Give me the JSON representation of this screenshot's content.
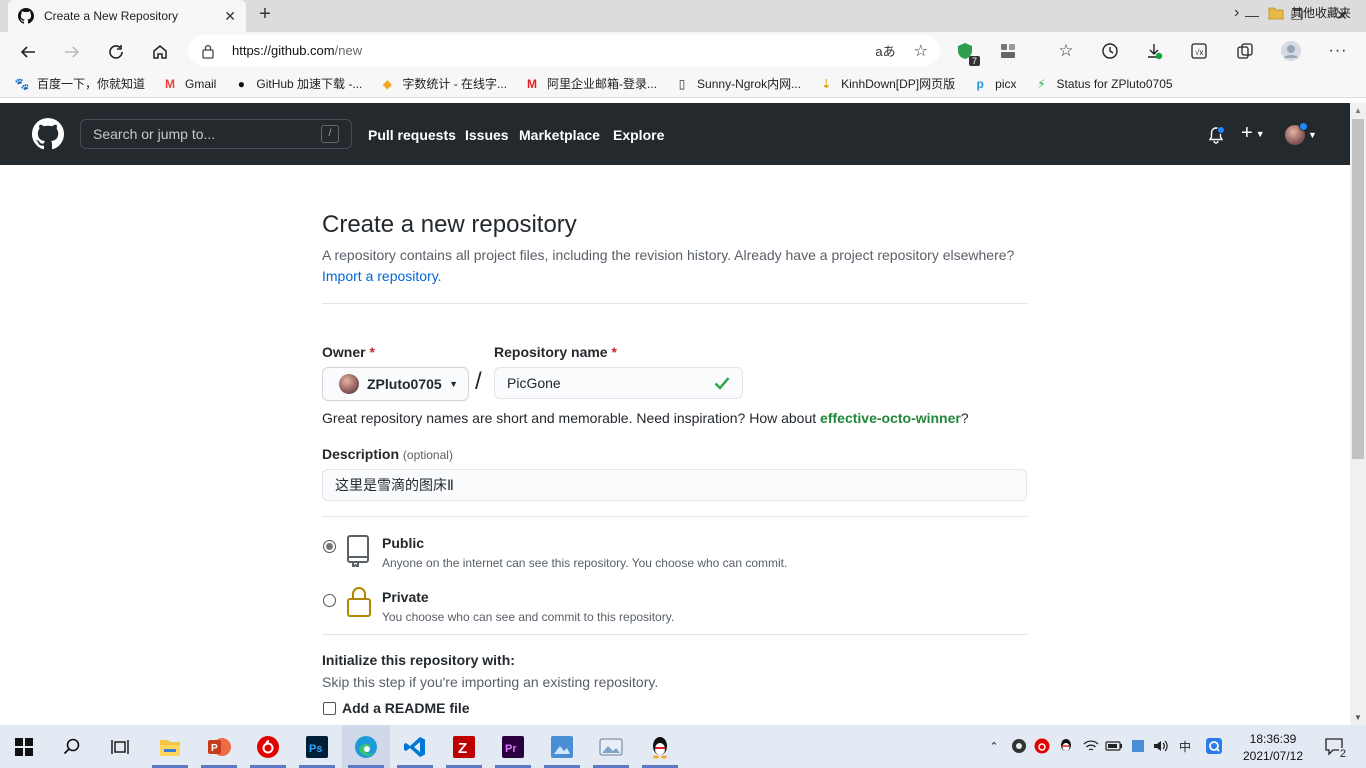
{
  "browser": {
    "tab_title": "Create a New Repository",
    "url_host": "https://github.com",
    "url_path": "/new",
    "extension_badge": "7",
    "bookmarks": [
      {
        "label": "百度一下，你就知道",
        "icon": "baidu-icon",
        "color": "#2932e1",
        "glyph": "🐾"
      },
      {
        "label": "Gmail",
        "icon": "gmail-icon",
        "color": "#ea4335",
        "glyph": "M"
      },
      {
        "label": "GitHub 加速下载 -...",
        "icon": "github-icon",
        "color": "#111111",
        "glyph": "●"
      },
      {
        "label": "字数统计 - 在线字...",
        "icon": "count-icon",
        "color": "#f5a623",
        "glyph": "◆"
      },
      {
        "label": "阿里企业邮箱-登录...",
        "icon": "aliyun-mail-icon",
        "color": "#e02020",
        "glyph": "M"
      },
      {
        "label": "Sunny-Ngrok内网...",
        "icon": "page-icon",
        "color": "#333333",
        "glyph": "▯"
      },
      {
        "label": "KinhDown[DP]网页版",
        "icon": "download-icon",
        "color": "#d9a400",
        "glyph": "⇣"
      },
      {
        "label": "picx",
        "icon": "picx-icon",
        "color": "#1e9bd7",
        "glyph": "p"
      },
      {
        "label": "Status for ZPluto0705",
        "icon": "status-icon",
        "color": "#2bb24c",
        "glyph": "⚡"
      }
    ],
    "other_bookmarks": "其他收藏夹"
  },
  "github": {
    "search_placeholder": "Search or jump to...",
    "search_shortcut": "/",
    "nav": [
      "Pull requests",
      "Issues",
      "Marketplace",
      "Explore"
    ],
    "plus_label": "+"
  },
  "form": {
    "title": "Create a new repository",
    "subtitle": "A repository contains all project files, including the revision history. Already have a project repository elsewhere?",
    "import_link": "Import a repository.",
    "owner_label": "Owner",
    "required_mark": "*",
    "owner_value": "ZPluto0705",
    "slash": "/",
    "repo_label": "Repository name",
    "repo_value": "PicGone",
    "hint_prefix": "Great repository names are short and memorable. Need inspiration? How about",
    "hint_suggestion": "effective-octo-winner",
    "hint_suffix": "?",
    "description_label": "Description",
    "description_optional": "(optional)",
    "description_value": "这里是雪滴的图床Ⅱ",
    "visibility": [
      {
        "title": "Public",
        "desc": "Anyone on the internet can see this repository. You choose who can commit.",
        "checked": true
      },
      {
        "title": "Private",
        "desc": "You choose who can see and commit to this repository.",
        "checked": false
      }
    ],
    "init_title": "Initialize this repository with:",
    "init_sub": "Skip this step if you're importing an existing repository.",
    "readme_label": "Add a README file"
  },
  "taskbar": {
    "time": "18:36:39",
    "date": "2021/07/12",
    "ime": "中",
    "notifications": "2"
  },
  "colors": {
    "gh_header": "#24292e",
    "link": "#0366d6",
    "suggestion": "#22863a",
    "success": "#28a745",
    "required": "#cb2431"
  }
}
